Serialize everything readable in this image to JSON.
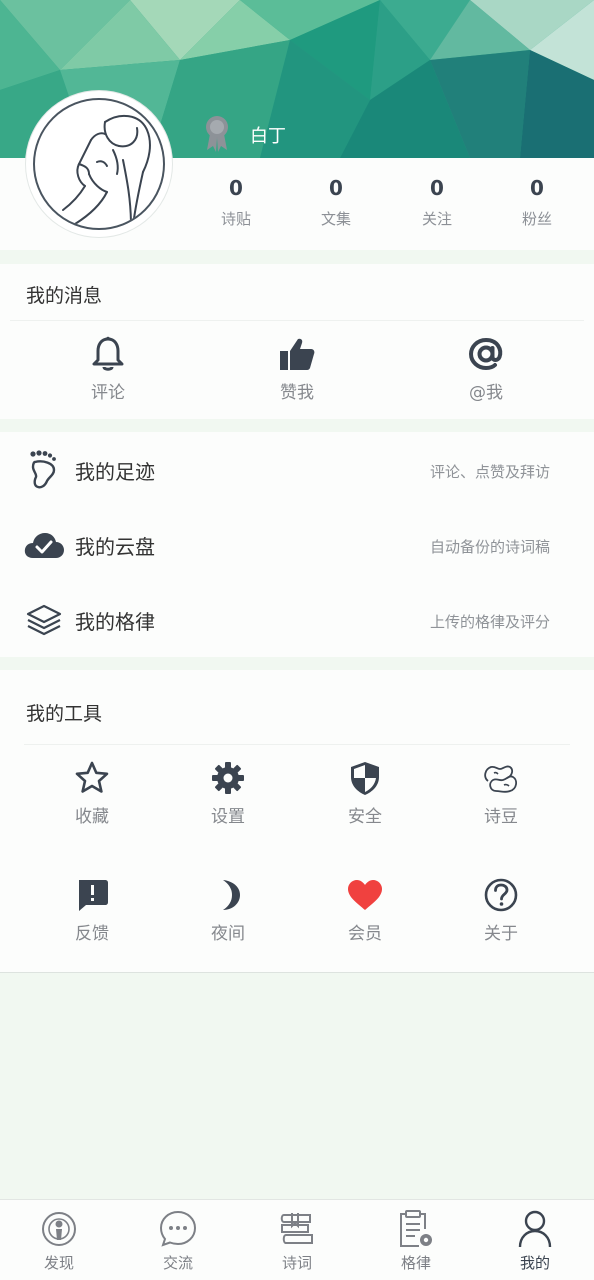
{
  "profile": {
    "username": "白丁",
    "stats": [
      {
        "value": "0",
        "label": "诗贴"
      },
      {
        "value": "0",
        "label": "文集"
      },
      {
        "value": "0",
        "label": "关注"
      },
      {
        "value": "0",
        "label": "粉丝"
      }
    ]
  },
  "messages": {
    "title": "我的消息",
    "items": [
      {
        "label": "评论",
        "icon": "bell-icon"
      },
      {
        "label": "赞我",
        "icon": "thumbs-up-icon"
      },
      {
        "label": "@我",
        "icon": "at-icon"
      }
    ]
  },
  "menu": [
    {
      "title": "我的足迹",
      "desc": "评论、点赞及拜访",
      "icon": "footprint-icon"
    },
    {
      "title": "我的云盘",
      "desc": "自动备份的诗词稿",
      "icon": "cloud-check-icon"
    },
    {
      "title": "我的格律",
      "desc": "上传的格律及评分",
      "icon": "layers-icon"
    }
  ],
  "tools": {
    "title": "我的工具",
    "items": [
      {
        "label": "收藏",
        "icon": "star-icon"
      },
      {
        "label": "设置",
        "icon": "gear-icon"
      },
      {
        "label": "安全",
        "icon": "shield-icon"
      },
      {
        "label": "诗豆",
        "icon": "beans-icon"
      },
      {
        "label": "反馈",
        "icon": "feedback-icon"
      },
      {
        "label": "夜间",
        "icon": "moon-icon"
      },
      {
        "label": "会员",
        "icon": "heart-icon"
      },
      {
        "label": "关于",
        "icon": "question-icon"
      }
    ]
  },
  "bottom_nav": [
    {
      "label": "发现",
      "icon": "discover-icon",
      "active": false
    },
    {
      "label": "交流",
      "icon": "chat-icon",
      "active": false
    },
    {
      "label": "诗词",
      "icon": "books-icon",
      "active": false
    },
    {
      "label": "格律",
      "icon": "clipboard-gear-icon",
      "active": false
    },
    {
      "label": "我的",
      "icon": "person-icon",
      "active": true
    }
  ],
  "colors": {
    "accent": "#3b4450",
    "heart": "#f0413f",
    "banner_teal": "#27a88a",
    "page_bg": "#f1f8f1"
  }
}
